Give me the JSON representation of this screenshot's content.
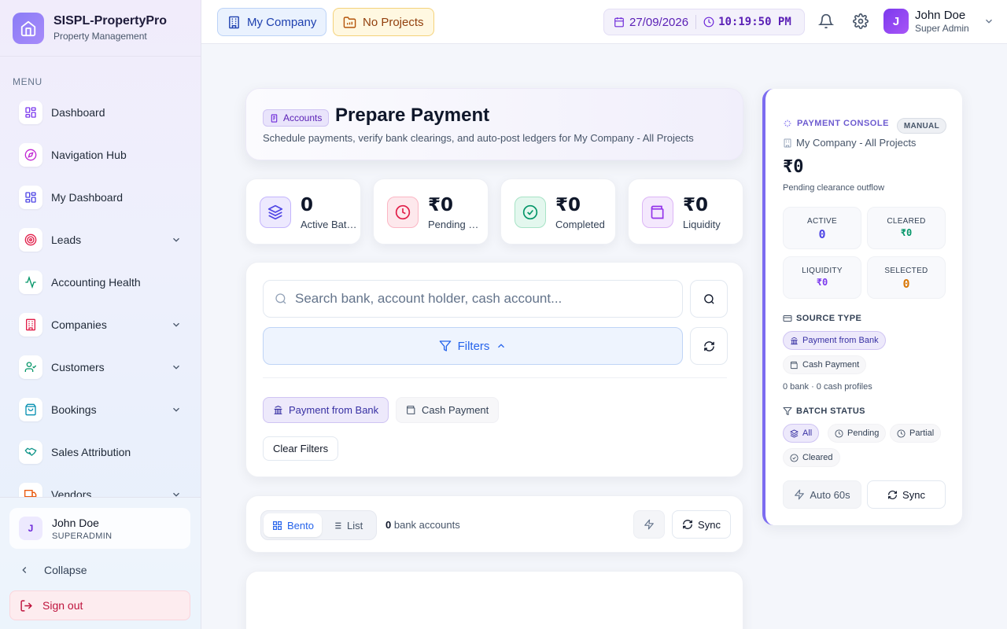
{
  "brand": {
    "title": "SISPL-PropertyPro",
    "subtitle": "Property Management"
  },
  "sidebar": {
    "menu_label": "MENU",
    "items": [
      {
        "label": "Dashboard",
        "icon": "grid-icon",
        "color": "#7c3aed",
        "has_children": false
      },
      {
        "label": "Navigation Hub",
        "icon": "compass-icon",
        "color": "#c026d3",
        "has_children": false
      },
      {
        "label": "My Dashboard",
        "icon": "grid-icon",
        "color": "#4f46e5",
        "has_children": false
      },
      {
        "label": "Leads",
        "icon": "target-icon",
        "color": "#e11d48",
        "has_children": true
      },
      {
        "label": "Accounting Health",
        "icon": "activity-icon",
        "color": "#059669",
        "has_children": false
      },
      {
        "label": "Companies",
        "icon": "building-icon",
        "color": "#e11d48",
        "has_children": true
      },
      {
        "label": "Customers",
        "icon": "user-check-icon",
        "color": "#059669",
        "has_children": true
      },
      {
        "label": "Bookings",
        "icon": "shopping-bag-icon",
        "color": "#0891b2",
        "has_children": true
      },
      {
        "label": "Sales Attribution",
        "icon": "handshake-icon",
        "color": "#0d9488",
        "has_children": false
      },
      {
        "label": "Vendors",
        "icon": "truck-icon",
        "color": "#ea580c",
        "has_children": true
      }
    ],
    "user": {
      "initial": "J",
      "name": "John Doe",
      "role": "SUPERADMIN"
    },
    "collapse_label": "Collapse",
    "signout_label": "Sign out"
  },
  "topbar": {
    "company_label": "My Company",
    "projects_label": "No Projects",
    "date": "27/09/2026",
    "time": "10:19:50 PM",
    "user": {
      "initial": "J",
      "name": "John Doe",
      "role": "Super Admin"
    }
  },
  "header": {
    "crumb": "Accounts",
    "title": "Prepare Payment",
    "subtitle": "Schedule payments, verify bank clearings, and auto-post ledgers for My Company - All Projects"
  },
  "stats": [
    {
      "value": "0",
      "label": "Active Batches",
      "icon": "layers-icon",
      "bg": "#ede9fe",
      "border": "#c4b5fd",
      "color": "#4f46e5"
    },
    {
      "value": "₹0",
      "label": "Pending Clearance",
      "icon": "clock-icon",
      "bg": "#fde8ec",
      "border": "#fbb6c4",
      "color": "#e11d48"
    },
    {
      "value": "₹0",
      "label": "Completed",
      "icon": "check-circle-icon",
      "bg": "#e3f7ee",
      "border": "#a7e3c6",
      "color": "#059669"
    },
    {
      "value": "₹0",
      "label": "Liquidity",
      "icon": "wallet-icon",
      "bg": "#f4e8fd",
      "border": "#dcb5f6",
      "color": "#9333ea"
    }
  ],
  "filters": {
    "search_placeholder": "Search bank, account holder, cash account...",
    "search_value": "",
    "filters_label": "Filters",
    "source_bank": "Payment from Bank",
    "source_cash": "Cash Payment",
    "clear_label": "Clear Filters"
  },
  "view": {
    "bento_label": "Bento",
    "list_label": "List",
    "count": "0",
    "count_suffix": "bank accounts",
    "sync_label": "Sync"
  },
  "console": {
    "title": "PAYMENT CONSOLE",
    "mode": "MANUAL",
    "company": "My Company - All Projects",
    "amount": "₹0",
    "note": "Pending clearance outflow",
    "kpis": [
      {
        "label": "ACTIVE",
        "value": "0",
        "color": "#4f46e5"
      },
      {
        "label": "CLEARED",
        "value": "₹0",
        "color": "#059669"
      },
      {
        "label": "LIQUIDITY",
        "value": "₹0",
        "color": "#7c3aed"
      },
      {
        "label": "SELECTED",
        "value": "0",
        "color": "#d97706"
      }
    ],
    "source_head": "SOURCE TYPE",
    "source_bank": "Payment from Bank",
    "source_cash": "Cash Payment",
    "source_note": "0 bank · 0 cash profiles",
    "status_head": "BATCH STATUS",
    "statuses": [
      "All",
      "Pending",
      "Partial",
      "Cleared"
    ],
    "auto_label": "Auto 60s",
    "sync_label": "Sync"
  }
}
